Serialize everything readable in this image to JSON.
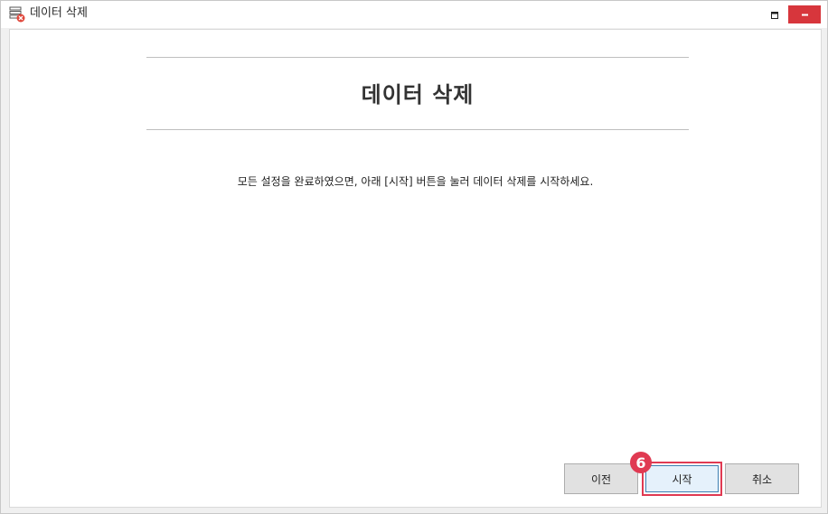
{
  "window": {
    "title": "데이터 삭제",
    "icon": "database-delete-icon",
    "close_color": "#d7363c"
  },
  "main": {
    "heading": "데이터 삭제",
    "message": "모든 설정을 완료하였으면, 아래 [시작] 버튼을 눌러 데이터 삭제를 시작하세요."
  },
  "buttons": {
    "prev_label": "이전",
    "start_label": "시작",
    "cancel_label": "취소"
  },
  "annotation": {
    "step_number": "6",
    "highlight_color": "#e03a52"
  }
}
